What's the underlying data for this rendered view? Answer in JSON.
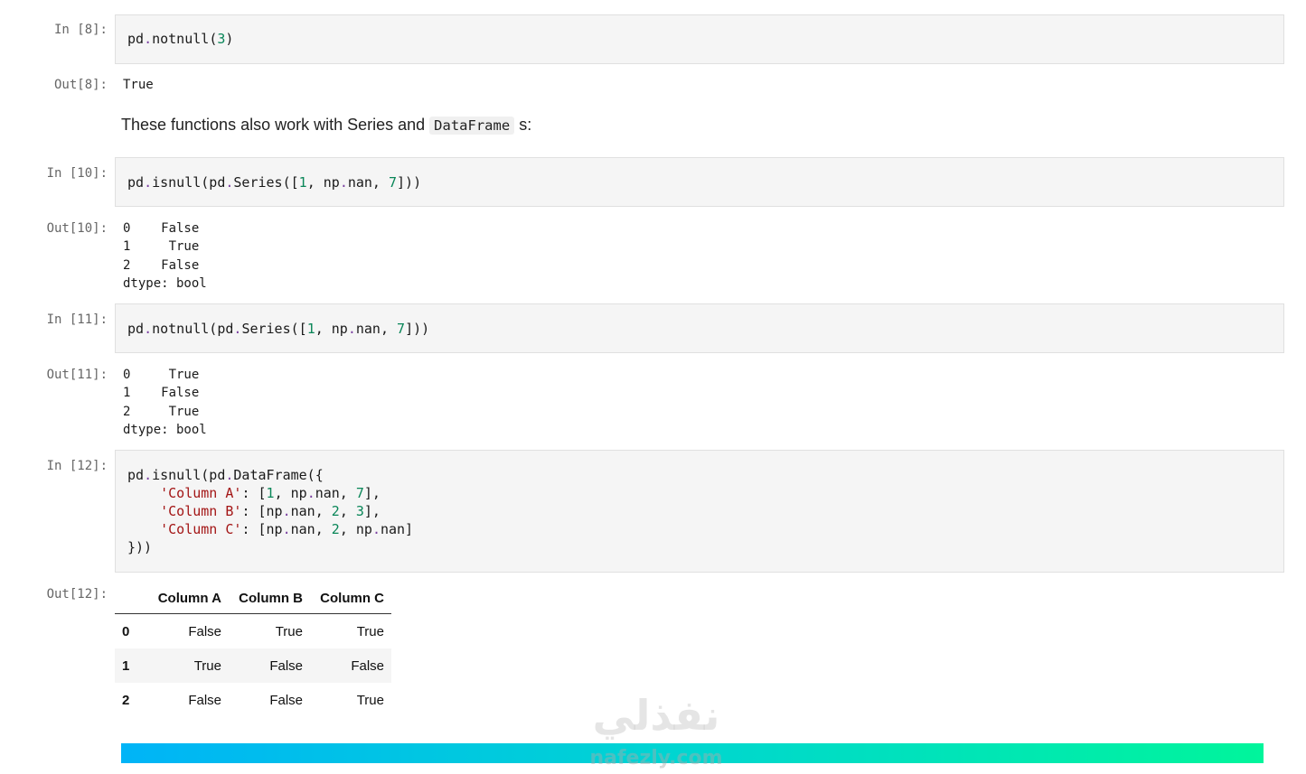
{
  "cells": [
    {
      "in_prompt": "In [8]:",
      "out_prompt": "Out[8]:",
      "output": "True"
    },
    {
      "in_prompt": "In [10]:",
      "out_prompt": "Out[10]:",
      "output": "0    False\n1     True\n2    False\ndtype: bool"
    },
    {
      "in_prompt": "In [11]:",
      "out_prompt": "Out[11]:",
      "output": "0     True\n1    False\n2     True\ndtype: bool"
    },
    {
      "in_prompt": "In [12]:",
      "out_prompt": "Out[12]:"
    }
  ],
  "code": {
    "c8": {
      "a": "pd",
      "b": ".",
      "c": "notnull",
      "d": "(",
      "e": "3",
      "f": ")"
    },
    "c10": {
      "a": "pd",
      "b": ".",
      "c": "isnull(pd",
      "d": ".",
      "e": "Series([",
      "f": "1",
      "g": ", np",
      "h": ".",
      "i": "nan, ",
      "j": "7",
      "k": "]))"
    },
    "c11": {
      "a": "pd",
      "b": ".",
      "c": "notnull(pd",
      "d": ".",
      "e": "Series([",
      "f": "1",
      "g": ", np",
      "h": ".",
      "i": "nan, ",
      "j": "7",
      "k": "]))"
    },
    "c12": {
      "l1a": "pd",
      "l1b": ".",
      "l1c": "isnull(pd",
      "l1d": ".",
      "l1e": "DataFrame({",
      "l2a": "    ",
      "l2b": "'Column A'",
      "l2c": ": [",
      "l2d": "1",
      "l2e": ", np",
      "l2f": ".",
      "l2g": "nan, ",
      "l2h": "7",
      "l2i": "],",
      "l3a": "    ",
      "l3b": "'Column B'",
      "l3c": ": [np",
      "l3d": ".",
      "l3e": "nan, ",
      "l3f": "2",
      "l3g": ", ",
      "l3h": "3",
      "l3i": "],",
      "l4a": "    ",
      "l4b": "'Column C'",
      "l4c": ": [np",
      "l4d": ".",
      "l4e": "nan, ",
      "l4f": "2",
      "l4g": ", np",
      "l4h": ".",
      "l4i": "nan]",
      "l5": "}))"
    }
  },
  "markdown": {
    "before": "These functions also work with Series and ",
    "code": "DataFrame",
    "after": "s:"
  },
  "dataframe": {
    "columns": [
      "Column A",
      "Column B",
      "Column C"
    ],
    "rows": [
      {
        "index": "0",
        "values": [
          "False",
          "True",
          "True"
        ]
      },
      {
        "index": "1",
        "values": [
          "True",
          "False",
          "False"
        ]
      },
      {
        "index": "2",
        "values": [
          "False",
          "False",
          "True"
        ]
      }
    ]
  },
  "watermark": {
    "arabic": "نفذلي",
    "latin": "nafezly.com"
  },
  "colors": {
    "cell_bg": "#f5f5f5",
    "number": "#098658",
    "string": "#a31515",
    "banner_start": "#00b4f7",
    "banner_end": "#00f59b"
  }
}
